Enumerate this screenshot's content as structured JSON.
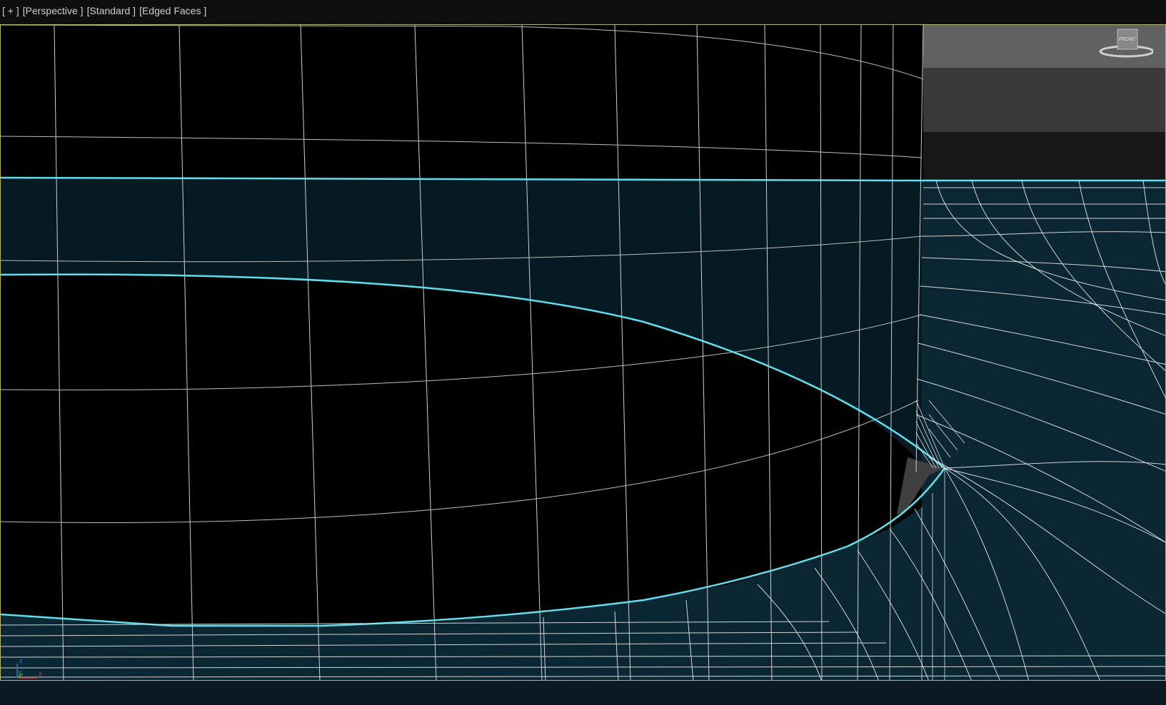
{
  "viewport": {
    "labels": [
      "[ + ]",
      "[Perspective ]",
      "[Standard ]",
      "[Edged Faces ]"
    ]
  },
  "viewcube": {
    "face_label": "FRONT"
  },
  "axes": {
    "x": "x",
    "y": "y",
    "z": "z"
  },
  "colors": {
    "selection_edge": "#5fe0ee",
    "wire": "#d8d8d8",
    "floor_fill": "#0a2733",
    "band_fill": "#061a23",
    "frame": "#b8b46a",
    "header_bg": "#0e0e0e"
  }
}
